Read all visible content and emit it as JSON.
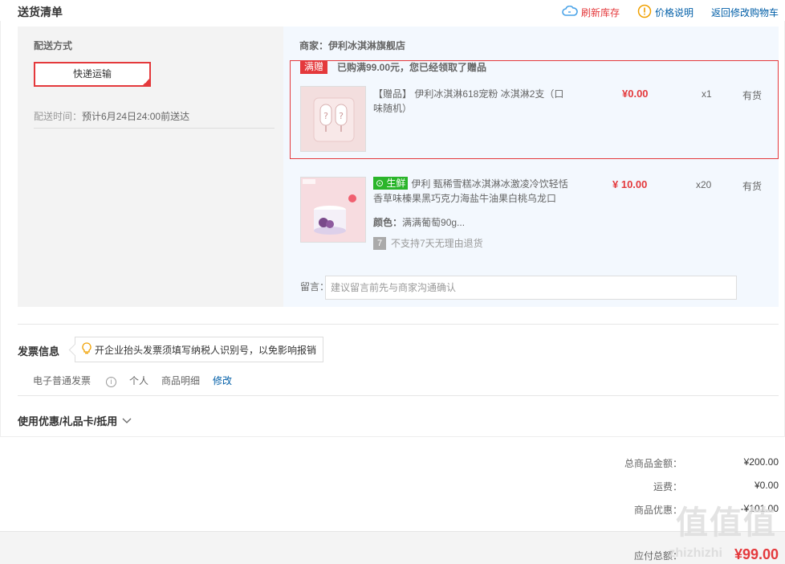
{
  "header": {
    "title": "送货清单",
    "refresh": "刷新库存",
    "price_note": "价格说明",
    "back_cart": "返回修改购物车"
  },
  "shipping": {
    "label": "配送方式",
    "method": "快递运输",
    "time_label": "配送时间：",
    "time_value": "预计6月24日24:00前送达"
  },
  "merchant": "商家：伊利冰淇淋旗舰店",
  "gift": {
    "badge": "满赠",
    "note": "已购满99.00元，您已经领取了赠品"
  },
  "items": [
    {
      "name": "【赠品】 伊利冰淇淋618宠粉 冰淇淋2支（口味随机）",
      "price": "¥0.00",
      "qty": "x1",
      "stock": "有货"
    },
    {
      "tag": "生鲜",
      "name": "伊利 甄稀雪糕冰淇淋冰激凌冷饮轻恬香草味榛果黑巧克力海盐牛油果白桃乌龙口",
      "color_label": "颜色：",
      "color_value": "满满葡萄90g...",
      "no_return": "不支持7天无理由退货",
      "price": "¥ 10.00",
      "qty": "x20",
      "stock": "有货"
    }
  ],
  "message": {
    "label": "留言：",
    "placeholder": "建议留言前先与商家沟通确认"
  },
  "invoice": {
    "title": "发票信息",
    "tip": "开企业抬头发票须填写纳税人识别号，以免影响报销",
    "type": "电子普通发票",
    "holder": "个人",
    "content": "商品明细",
    "edit": "修改"
  },
  "coupon": {
    "label": "使用优惠/礼品卡/抵用"
  },
  "summary": {
    "goods_total_label": "总商品金额：",
    "goods_total": "¥200.00",
    "freight_label": "运费：",
    "freight": "¥0.00",
    "discount_label": "商品优惠：",
    "discount": "-¥101.00",
    "payable_label": "应付总额：",
    "payable": "¥99.00"
  },
  "watermark": {
    "brand": "值值值",
    "url": "zhizhizhi"
  },
  "colors": {
    "accent_red": "#e4393c",
    "link_blue": "#005ea7",
    "fresh_green": "#2ab52a"
  }
}
